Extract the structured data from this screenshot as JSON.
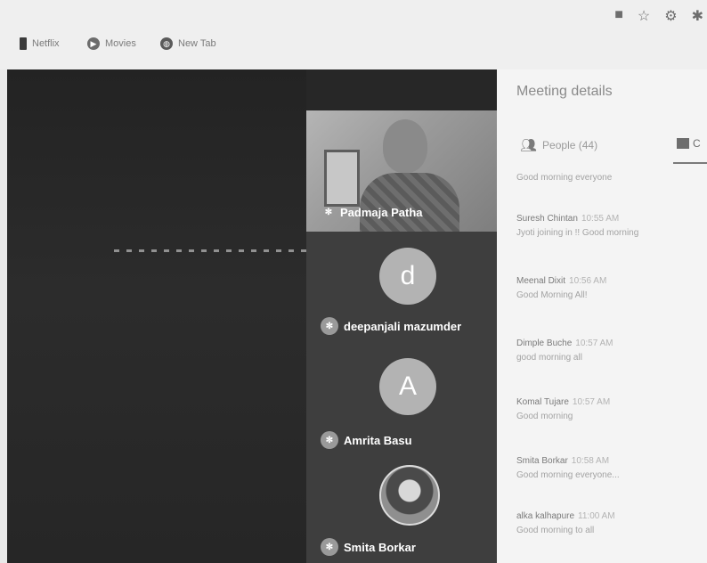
{
  "bookmarks": [
    {
      "label": "Netflix",
      "icon": "netflix-icon"
    },
    {
      "label": "Movies",
      "icon": "play-icon"
    },
    {
      "label": "New Tab",
      "icon": "globe-icon"
    }
  ],
  "toolbar_icons": [
    "bookmark-star-icon",
    "extension-icon"
  ],
  "video": {
    "presenter_name": "Padmaja Patha",
    "participants": [
      {
        "name": "deepanjali mazumder",
        "avatar_letter": "d"
      },
      {
        "name": "Amrita Basu",
        "avatar_letter": "A"
      },
      {
        "name": "Smita Borkar",
        "avatar_letter": ""
      }
    ]
  },
  "panel": {
    "title": "Meeting details",
    "people_tab": "People (44)",
    "chat_tab": "C",
    "first_message": "Good morning everyone",
    "messages": [
      {
        "sender": "Suresh Chintan",
        "time": "10:55 AM",
        "text": "Jyoti joining in !! Good morning"
      },
      {
        "sender": "Meenal Dixit",
        "time": "10:56 AM",
        "text": "Good Morning All!"
      },
      {
        "sender": "Dimple Buche",
        "time": "10:57 AM",
        "text": "good morning all"
      },
      {
        "sender": "Komal Tujare",
        "time": "10:57 AM",
        "text": "Good morning"
      },
      {
        "sender": "Smita Borkar",
        "time": "10:58 AM",
        "text": "Good morning everyone..."
      },
      {
        "sender": "alka kalhapure",
        "time": "11:00 AM",
        "text": "Good morning to all"
      }
    ]
  }
}
